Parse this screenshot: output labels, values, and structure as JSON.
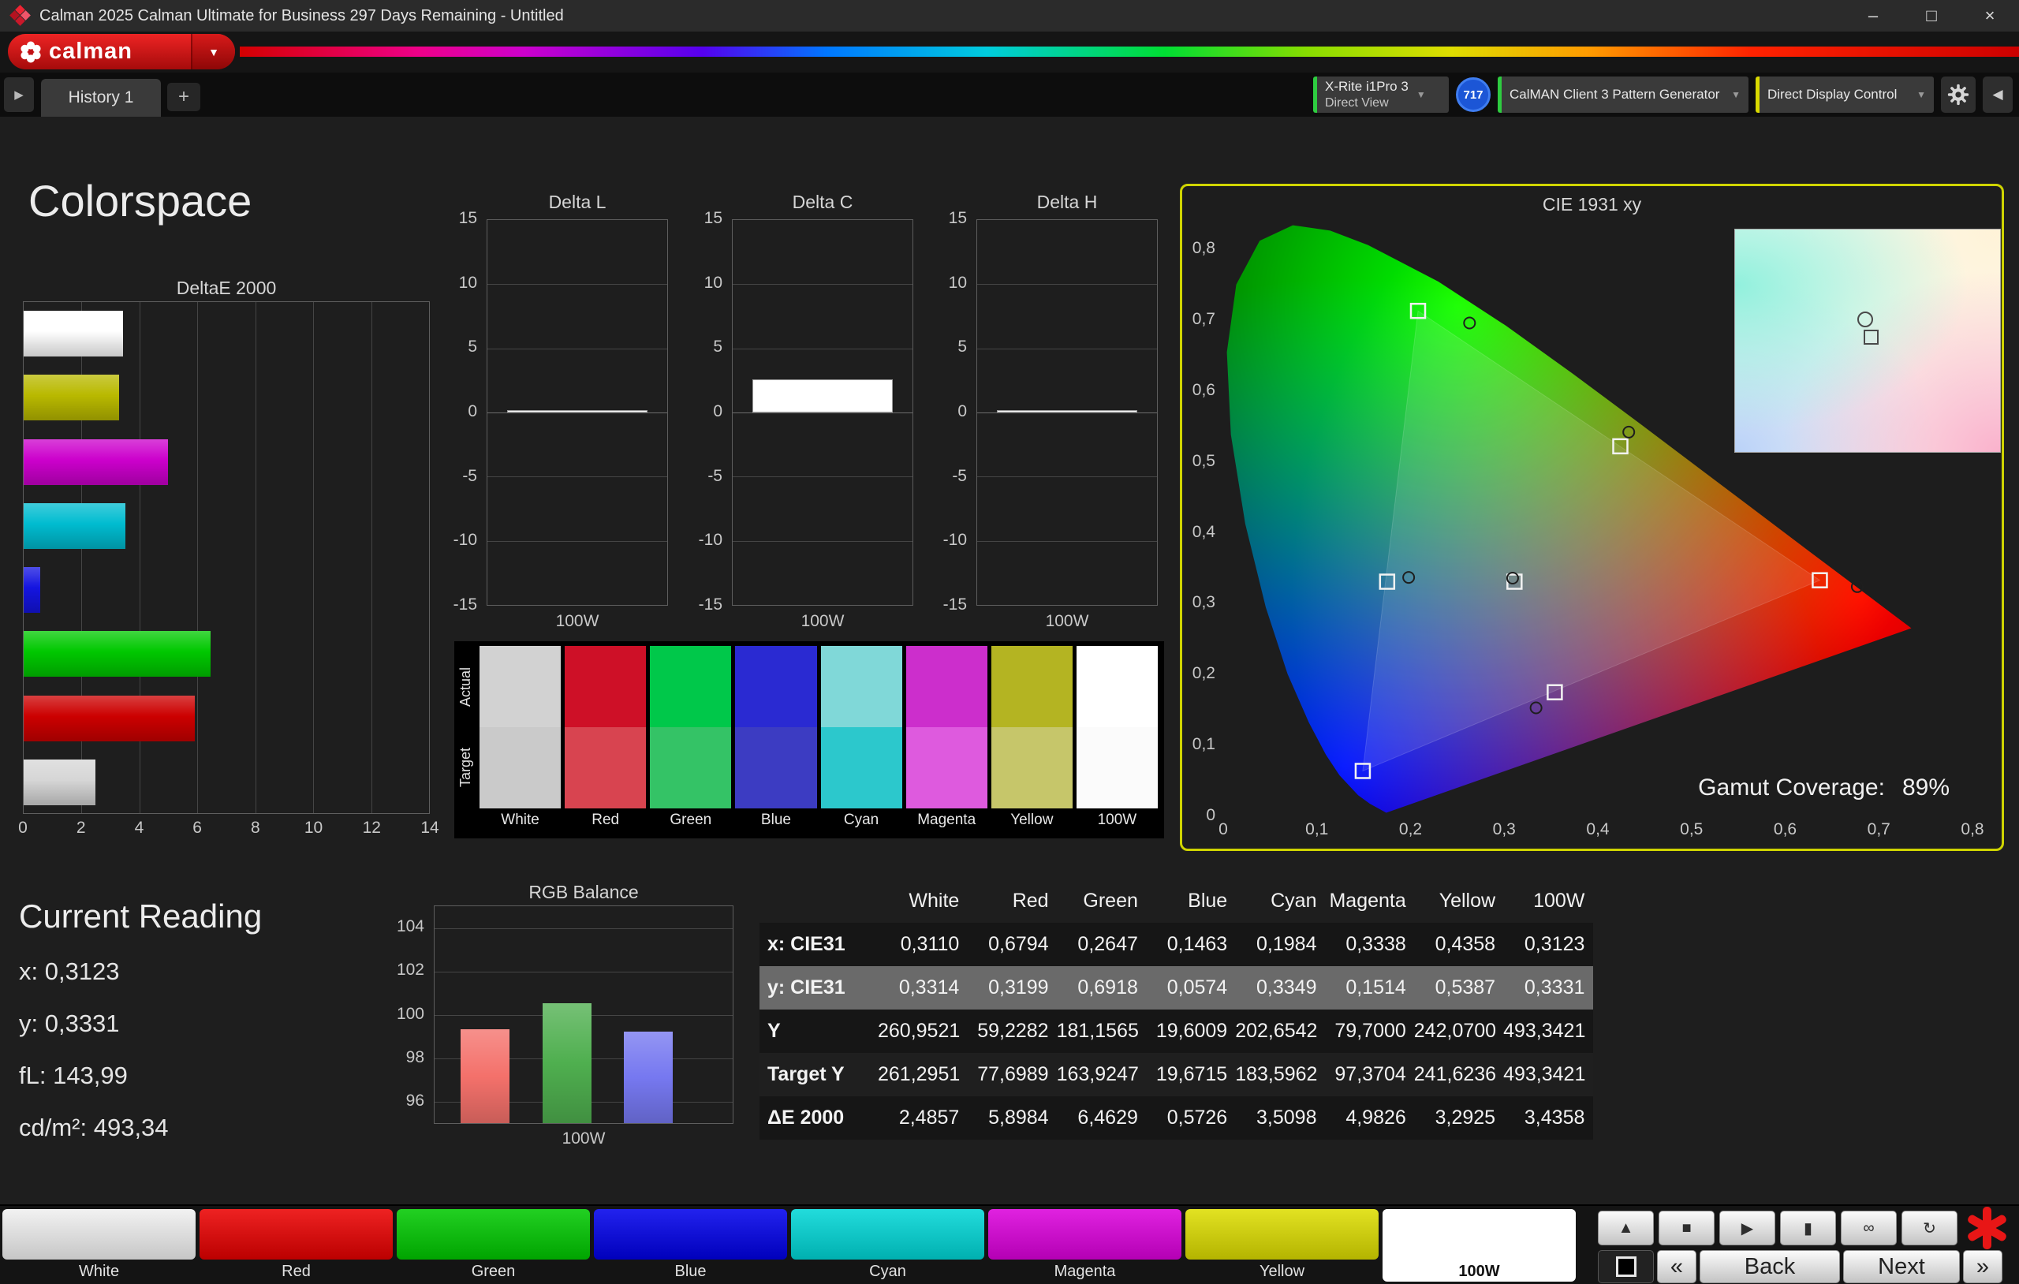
{
  "window": {
    "title": "Calman 2025 Calman Ultimate for Business 297 Days Remaining  - Untitled",
    "controls": {
      "minimize": "–",
      "maximize": "□",
      "close": "×"
    }
  },
  "brand": {
    "logo_text": "calman",
    "accent_red": "#d41217"
  },
  "tabs": {
    "history_tab": "History 1",
    "add_tab": "+"
  },
  "toolbar": {
    "meter": {
      "line1": "X-Rite i1Pro 3",
      "line2": "Direct View"
    },
    "badge": "717",
    "pattern_generator": "CalMAN Client 3 Pattern Generator",
    "display_control": "Direct Display Control"
  },
  "page": {
    "title": "Colorspace"
  },
  "current_reading": {
    "title": "Current Reading",
    "lines": [
      "x: 0,3123",
      "y: 0,3331",
      "fL: 143,99",
      "cd/m²: 493,34"
    ]
  },
  "gamut_coverage": {
    "label": "Gamut Coverage:",
    "value": "89%"
  },
  "delta_axis_label": "100W",
  "chart_data": [
    {
      "id": "deltae2000",
      "type": "bar",
      "orientation": "horizontal",
      "title": "DeltaE 2000",
      "xlim": [
        0,
        14
      ],
      "xticks": [
        0,
        2,
        4,
        6,
        8,
        10,
        12,
        14
      ],
      "categories": [
        "100W",
        "Yellow",
        "Magenta",
        "Cyan",
        "Blue",
        "Green",
        "Red",
        "White"
      ],
      "values": [
        3.4358,
        3.2925,
        4.9826,
        3.5098,
        0.5726,
        6.4629,
        5.8984,
        2.4857
      ],
      "colors": [
        "#ffffff",
        "#b9b900",
        "#cc00cc",
        "#00bcd0",
        "#1414e0",
        "#00c800",
        "#cc0000",
        "#d6d6d6"
      ]
    },
    {
      "id": "delta_l",
      "type": "bar",
      "title": "Delta L",
      "ylim": [
        -15,
        15
      ],
      "yticks": [
        15,
        10,
        5,
        0,
        -5,
        -10,
        -15
      ],
      "categories": [
        "100W"
      ],
      "values": [
        0
      ],
      "bar_color": "#ffffff"
    },
    {
      "id": "delta_c",
      "type": "bar",
      "title": "Delta C",
      "ylim": [
        -15,
        15
      ],
      "yticks": [
        15,
        10,
        5,
        0,
        -5,
        -10,
        -15
      ],
      "categories": [
        "100W"
      ],
      "values": [
        2.6
      ],
      "bar_color": "#ffffff"
    },
    {
      "id": "delta_h",
      "type": "bar",
      "title": "Delta H",
      "ylim": [
        -15,
        15
      ],
      "yticks": [
        15,
        10,
        5,
        0,
        -5,
        -10,
        -15
      ],
      "categories": [
        "100W"
      ],
      "values": [
        0
      ],
      "bar_color": "#ffffff"
    },
    {
      "id": "rgb_balance",
      "type": "bar",
      "title": "RGB Balance",
      "ylim": [
        95,
        105
      ],
      "yticks": [
        104,
        102,
        100,
        98,
        96
      ],
      "categories": [
        "Red",
        "Green",
        "Blue"
      ],
      "values": [
        99.3,
        100.5,
        99.2
      ],
      "colors": [
        "#f4716b",
        "#4faf4f",
        "#7678f0"
      ],
      "xlabel": "100W"
    },
    {
      "id": "cie1931",
      "type": "scatter",
      "title": "CIE 1931 xy",
      "xlim": [
        0,
        0.8
      ],
      "ylim": [
        0,
        0.8
      ],
      "xticks": [
        "0",
        "0,1",
        "0,2",
        "0,3",
        "0,4",
        "0,5",
        "0,6",
        "0,7",
        "0,8"
      ],
      "yticks": [
        "0,8",
        "0,7",
        "0,6",
        "0,5",
        "0,4",
        "0,3",
        "0,2",
        "0,1",
        "0"
      ],
      "gamut_triangle": {
        "red": [
          0.637,
          0.333
        ],
        "green": [
          0.208,
          0.713
        ],
        "blue": [
          0.149,
          0.064
        ]
      },
      "target_squares": [
        [
          0.311,
          0.331
        ],
        [
          0.637,
          0.333
        ],
        [
          0.208,
          0.713
        ],
        [
          0.149,
          0.064
        ],
        [
          0.175,
          0.331
        ],
        [
          0.354,
          0.175
        ],
        [
          0.424,
          0.522
        ]
      ],
      "measured_circles": [
        [
          0.309,
          0.336
        ],
        [
          0.263,
          0.696
        ],
        [
          0.433,
          0.542
        ],
        [
          0.677,
          0.324
        ],
        [
          0.334,
          0.153
        ],
        [
          0.198,
          0.337
        ]
      ],
      "coverage": "89%"
    }
  ],
  "swatch_panel": {
    "row_labels": [
      "Actual",
      "Target"
    ],
    "columns": [
      {
        "label": "White",
        "actual": "#d2d2d2",
        "target": "#cacaca"
      },
      {
        "label": "Red",
        "actual": "#ce1027",
        "target": "#d84450"
      },
      {
        "label": "Green",
        "actual": "#00c84a",
        "target": "#34c366"
      },
      {
        "label": "Blue",
        "actual": "#2a2ad2",
        "target": "#3c3cc2"
      },
      {
        "label": "Cyan",
        "actual": "#80d8d8",
        "target": "#2cc8cc"
      },
      {
        "label": "Magenta",
        "actual": "#cc2ecc",
        "target": "#de5ade"
      },
      {
        "label": "Yellow",
        "actual": "#b4b422",
        "target": "#c6c66a"
      },
      {
        "label": "100W",
        "actual": "#ffffff",
        "target": "#fbfbfb"
      }
    ]
  },
  "table": {
    "headers": [
      "",
      "White",
      "Red",
      "Green",
      "Blue",
      "Cyan",
      "Magenta",
      "Yellow",
      "100W"
    ],
    "rows": [
      {
        "label": "x: CIE31",
        "highlight": false,
        "values": [
          "0,3110",
          "0,6794",
          "0,2647",
          "0,1463",
          "0,1984",
          "0,3338",
          "0,4358",
          "0,3123"
        ]
      },
      {
        "label": "y: CIE31",
        "highlight": true,
        "values": [
          "0,3314",
          "0,3199",
          "0,6918",
          "0,0574",
          "0,3349",
          "0,1514",
          "0,5387",
          "0,3331"
        ]
      },
      {
        "label": "Y",
        "highlight": false,
        "values": [
          "260,9521",
          "59,2282",
          "181,1565",
          "19,6009",
          "202,6542",
          "79,7000",
          "242,0700",
          "493,3421"
        ]
      },
      {
        "label": "Target Y",
        "highlight": false,
        "values": [
          "261,2951",
          "77,6989",
          "163,9247",
          "19,6715",
          "183,5962",
          "97,3704",
          "241,6236",
          "493,3421"
        ]
      },
      {
        "label": "ΔE 2000",
        "highlight": false,
        "values": [
          "2,4857",
          "5,8984",
          "6,4629",
          "0,5726",
          "3,5098",
          "4,9826",
          "3,2925",
          "3,4358"
        ]
      }
    ]
  },
  "pattern_buttons": [
    {
      "label": "White",
      "color_top": "#f2f2f2",
      "color_bottom": "#c6c6c6",
      "text": "#e2e2e2"
    },
    {
      "label": "Red",
      "color_top": "#ee2222",
      "color_bottom": "#bb0000",
      "text": "#e2e2e2"
    },
    {
      "label": "Green",
      "color_top": "#22d022",
      "color_bottom": "#00a400",
      "text": "#e2e2e2"
    },
    {
      "label": "Blue",
      "color_top": "#2222ee",
      "color_bottom": "#0000bb",
      "text": "#e2e2e2"
    },
    {
      "label": "Cyan",
      "color_top": "#22dcdc",
      "color_bottom": "#00b0b0",
      "text": "#e2e2e2"
    },
    {
      "label": "Magenta",
      "color_top": "#e022e0",
      "color_bottom": "#b400b4",
      "text": "#e2e2e2"
    },
    {
      "label": "Yellow",
      "color_top": "#e2e222",
      "color_bottom": "#b4b400",
      "text": "#e2e2e2"
    },
    {
      "label": "100W",
      "color_top": "#ffffff",
      "color_bottom": "#ffffff",
      "text": "#111111"
    }
  ],
  "transport": {
    "icons": [
      {
        "name": "eject",
        "glyph": "▲"
      },
      {
        "name": "stop",
        "glyph": "■"
      },
      {
        "name": "play",
        "glyph": "▶"
      },
      {
        "name": "pause",
        "glyph": "▮"
      },
      {
        "name": "loop",
        "glyph": "∞"
      },
      {
        "name": "refresh",
        "glyph": "↻"
      }
    ],
    "chevron_left": "«",
    "back": "Back",
    "next": "Next",
    "chevron_right": "»"
  }
}
